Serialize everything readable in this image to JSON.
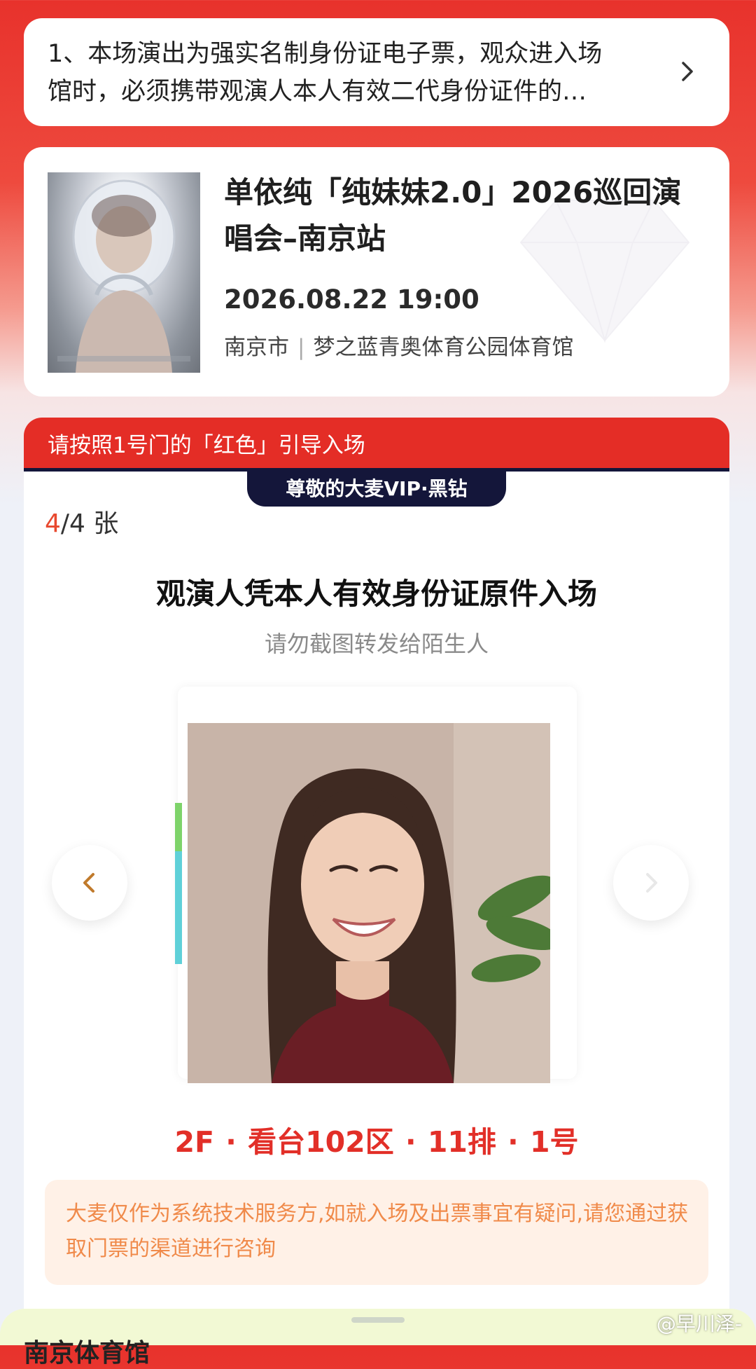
{
  "notice": {
    "line1": "1、本场演出为强实名制身份证电子票，观众进入场",
    "line2": "馆时，必须携带观演人本人有效二代身份证件的…",
    "icon": "chevron-right-icon"
  },
  "event": {
    "title": "单依纯「纯妹妹2.0」2026巡回演唱会–南京站",
    "datetime": "2026.08.22 19:00",
    "city": "南京市",
    "separator": "|",
    "venue": "梦之蓝青奥体育公园体育馆"
  },
  "ticket": {
    "banner": "请按照1号门的「红色」引导入场",
    "vip_badge": "尊敬的大麦VIP·黑钻",
    "count_current": "4",
    "count_rest": "/4 张",
    "headline": "观演人凭本人有效身份证原件入场",
    "subline": "请勿截图转发给陌生人",
    "seat": "2F · 看台102区 · 11排 · 1号",
    "tip": "大麦仅作为系统技术服务方,如就入场及出票事宜有疑问,请您通过获取门票的渠道进行咨询"
  },
  "sheet": {
    "title": "南京体育馆"
  },
  "watermark": "@早川泽-",
  "colors": {
    "brand_red": "#e42d26",
    "vip_navy": "#14163a",
    "seat_red": "#e22f28",
    "tip_orange": "#f08a4a"
  }
}
